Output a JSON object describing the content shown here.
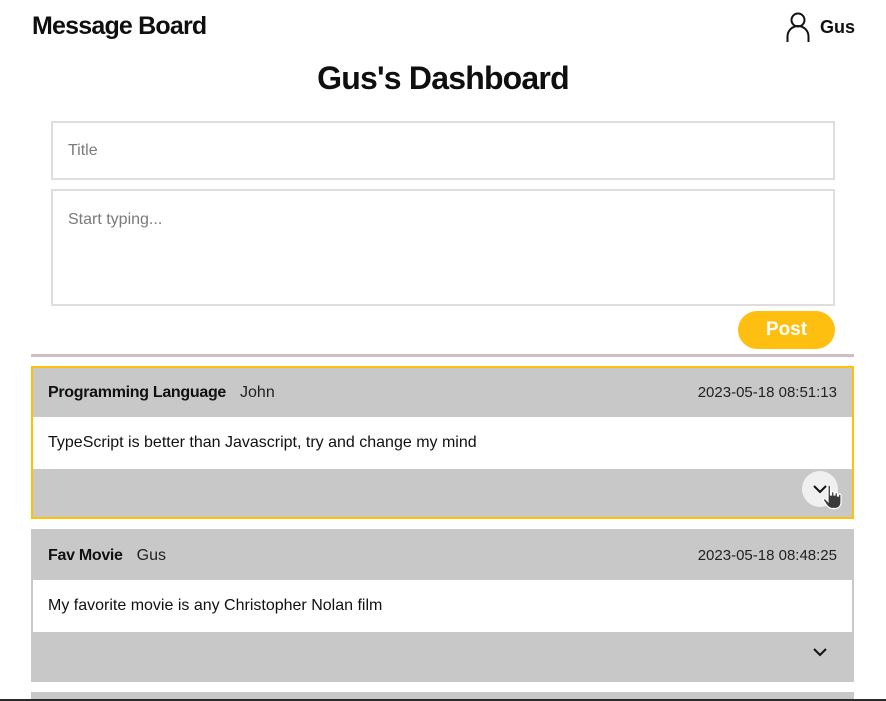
{
  "app": {
    "title": "Message Board"
  },
  "user": {
    "name": "Gus",
    "icon": "user-icon"
  },
  "dashboard": {
    "title": "Gus's Dashboard"
  },
  "composer": {
    "title_placeholder": "Title",
    "title_value": "",
    "body_placeholder": "Start typing...",
    "body_value": "",
    "post_label": "Post",
    "accent_color": "#ffbf10"
  },
  "posts": [
    {
      "title": "Programming Language",
      "author": "John",
      "timestamp": "2023-05-18 08:51:13",
      "body": "TypeScript is better than Javascript, try and change my mind",
      "expand_icon": "chevron-down-icon",
      "highlighted": true
    },
    {
      "title": "Fav Movie",
      "author": "Gus",
      "timestamp": "2023-05-18 08:48:25",
      "body": "My favorite movie is any Christopher Nolan film",
      "expand_icon": "chevron-down-icon",
      "highlighted": false
    }
  ],
  "colors": {
    "card_background": "#c8c8c8",
    "highlight_border": "#ffc107",
    "divider": "#cbbfcd"
  }
}
